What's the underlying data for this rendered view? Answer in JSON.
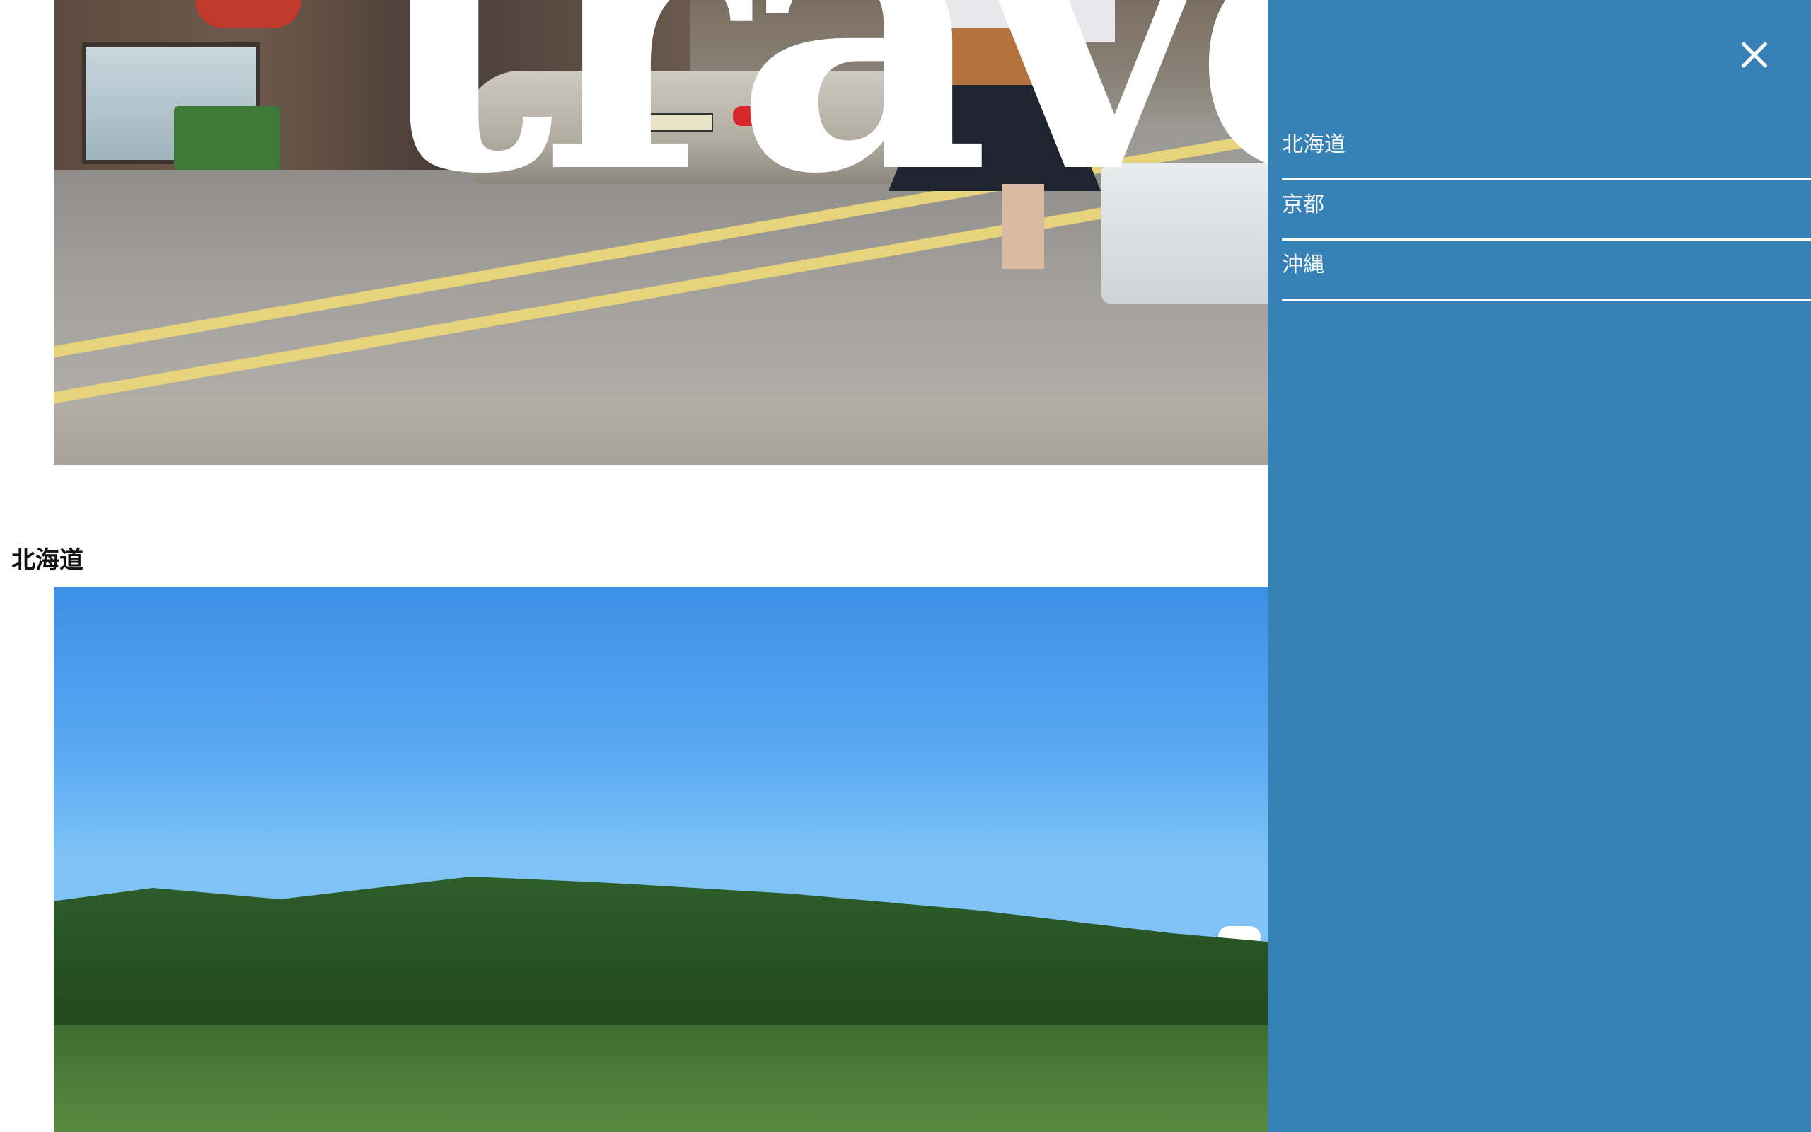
{
  "hero": {
    "title": "travel"
  },
  "section": {
    "title": "北海道"
  },
  "menu": {
    "close_icon": "close-icon",
    "items": [
      {
        "label": "北海道"
      },
      {
        "label": "京都"
      },
      {
        "label": "沖縄"
      }
    ]
  },
  "colors": {
    "menu_background": "#3682b7",
    "menu_text": "#ffffff",
    "hero_title": "#ffffff"
  }
}
